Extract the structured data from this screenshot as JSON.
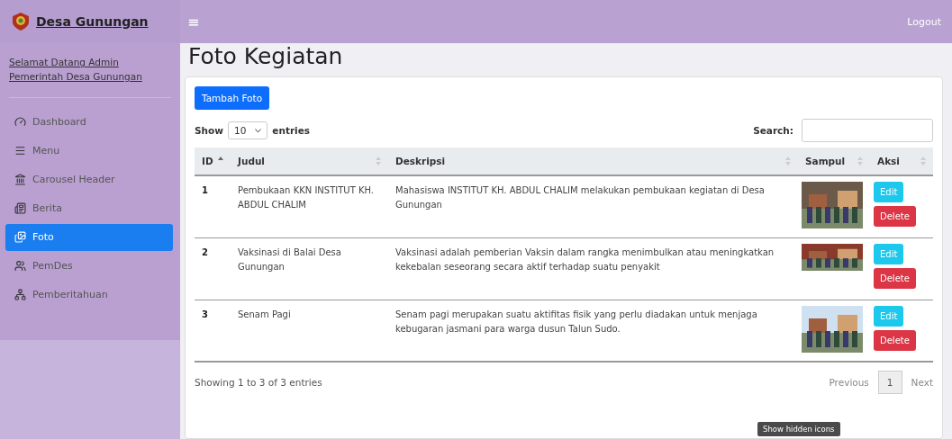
{
  "brand": "Desa Gunungan",
  "topbar": {
    "menu_glyph": "≡",
    "logout": "Logout"
  },
  "sidebar": {
    "welcome": "Selamat Datang Admin Pemerintah Desa Gunungan",
    "items": [
      {
        "label": "Dashboard",
        "selected": false
      },
      {
        "label": "Menu",
        "selected": false
      },
      {
        "label": "Carousel Header",
        "selected": false
      },
      {
        "label": "Berita",
        "selected": false
      },
      {
        "label": "Foto",
        "selected": true
      },
      {
        "label": "PemDes",
        "selected": false
      },
      {
        "label": "Pemberitahuan",
        "selected": false
      }
    ]
  },
  "page_title": "Foto Kegiatan",
  "add_button": "Tambah Foto",
  "length": {
    "show": "Show",
    "value": "10",
    "entries": "entries"
  },
  "search": {
    "label": "Search:"
  },
  "table": {
    "columns": [
      {
        "label": "ID",
        "sorted": true
      },
      {
        "label": "Judul",
        "sorted": false
      },
      {
        "label": "Deskripsi",
        "sorted": false
      },
      {
        "label": "Sampul",
        "sorted": false
      },
      {
        "label": "Aksi",
        "sorted": false
      }
    ],
    "rows": [
      {
        "id": "1",
        "judul": "Pembukaan KKN INSTITUT KH. ABDUL CHALIM",
        "deskripsi": "Mahasiswa INSTITUT KH. ABDUL CHALIM melakukan pembukaan kegiatan di Desa Gunungan",
        "edit": "Edit",
        "delete": "Delete"
      },
      {
        "id": "2",
        "judul": "Vaksinasi di Balai Desa Gunungan",
        "deskripsi": "Vaksinasi adalah pemberian Vaksin dalam rangka menimbulkan atau meningkatkan kekebalan seseorang secara aktif terhadap suatu penyakit",
        "edit": "Edit",
        "delete": "Delete"
      },
      {
        "id": "3",
        "judul": "Senam Pagi",
        "deskripsi": "Senam pagi merupakan suatu aktifitas fisik yang perlu diadakan untuk menjaga kebugaran jasmani para warga dusun Talun Sudo.",
        "edit": "Edit",
        "delete": "Delete"
      }
    ]
  },
  "info": "Showing 1 to 3 of 3 entries",
  "pagination": {
    "previous": "Previous",
    "pages": [
      {
        "label": "1",
        "selected": true
      }
    ],
    "next": "Next"
  },
  "tooltip": "Show hidden icons"
}
